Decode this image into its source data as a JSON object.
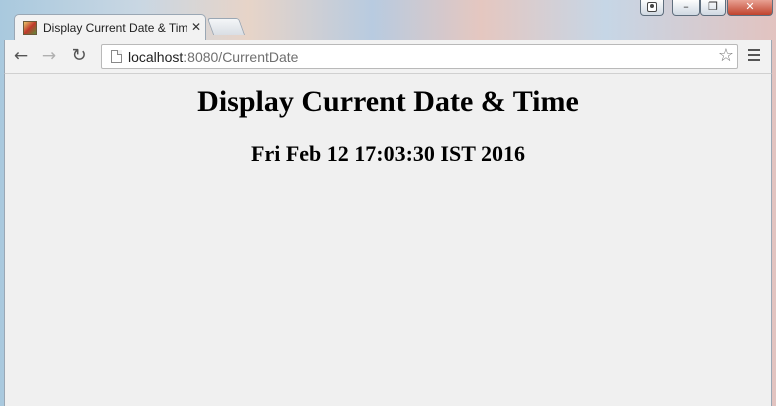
{
  "tab": {
    "title": "Display Current Date & Time",
    "close": "✕"
  },
  "window_controls": {
    "minimize": "–",
    "maximize": "❐",
    "close": "✕"
  },
  "toolbar": {
    "back_icon": "←",
    "forward_icon": "→",
    "reload_icon": "↻",
    "url_host": "localhost",
    "url_rest": ":8080/CurrentDate",
    "bookmark_icon": "☆"
  },
  "page": {
    "heading": "Display Current Date & Time",
    "current_date": "Fri Feb 12 17:03:30 IST 2016"
  }
}
